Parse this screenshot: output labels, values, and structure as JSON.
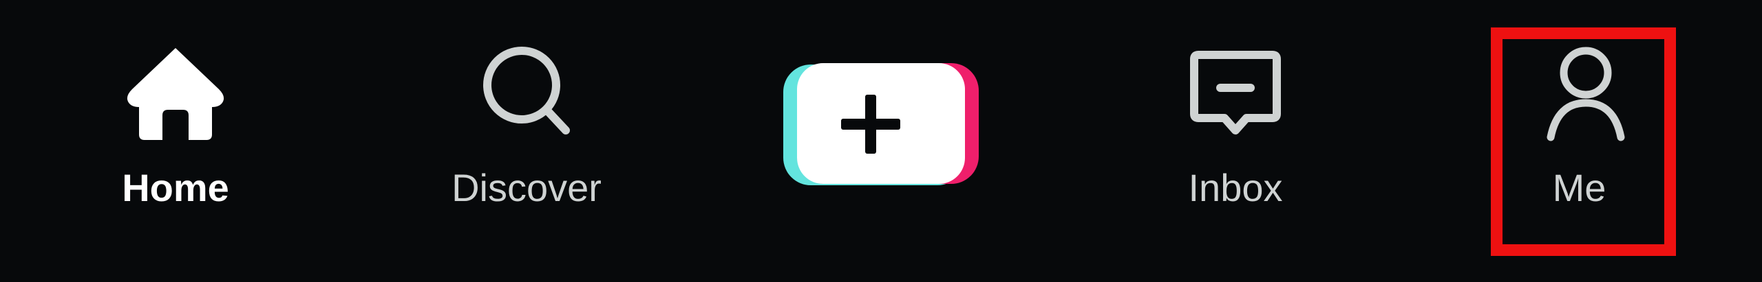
{
  "tabs": {
    "home": {
      "label": "Home",
      "icon": "home-icon",
      "selected": true
    },
    "discover": {
      "label": "Discover",
      "icon": "search-icon"
    },
    "create": {
      "label": "",
      "icon": "plus-icon"
    },
    "inbox": {
      "label": "Inbox",
      "icon": "message-icon"
    },
    "me": {
      "label": "Me",
      "icon": "person-icon"
    }
  },
  "colors": {
    "background": "#07090b",
    "active_text": "#ffffff",
    "inactive": "#cfd3d3",
    "create_cyan": "#63e4de",
    "create_pink": "#ef1f6b",
    "highlight": "#ee1111"
  }
}
